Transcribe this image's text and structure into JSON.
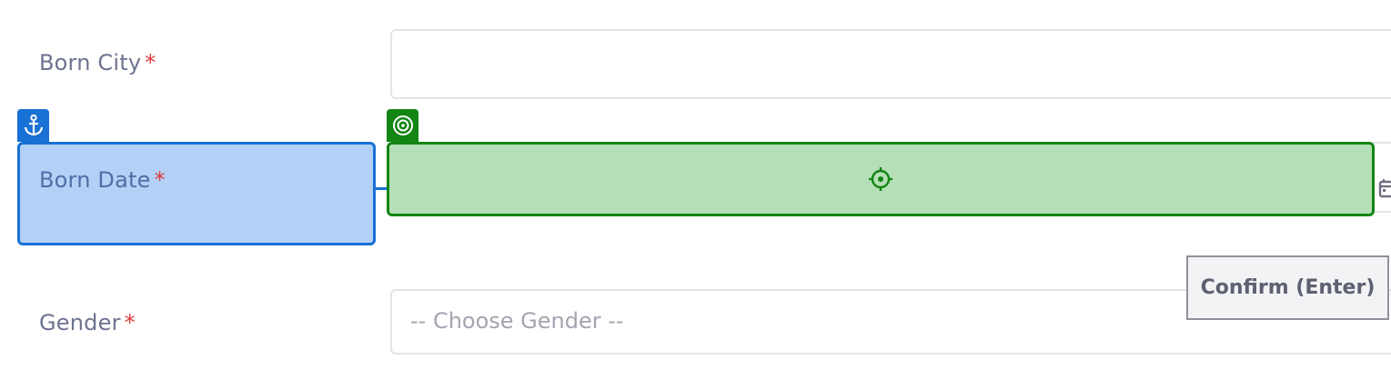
{
  "form": {
    "born_city": {
      "label": "Born City",
      "required_mark": "*",
      "value": ""
    },
    "born_date": {
      "label": "Born Date",
      "required_mark": "*"
    },
    "gender": {
      "label": "Gender",
      "required_mark": "*",
      "placeholder": "-- Choose Gender --"
    }
  },
  "overlay": {
    "anchor_icon": "anchor-icon",
    "target_icon": "target-icon",
    "crosshair_icon": "crosshair-icon",
    "anchor_color": "#1971d6",
    "target_color": "#138513"
  },
  "confirm": {
    "label": "Confirm (Enter)"
  }
}
